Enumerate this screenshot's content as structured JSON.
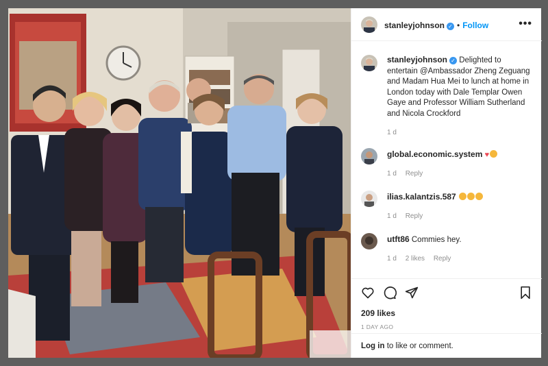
{
  "header": {
    "username": "stanleyjohnson",
    "follow_label": "Follow",
    "separator": "•",
    "more_label": "•••"
  },
  "caption": {
    "username": "stanleyjohnson",
    "text": "Delighted to entertain @Ambassador Zheng Zeguang and Madam Hua Mei to lunch at home in London today with Dale Templar Owen Gaye and Professor William Sutherland and Nicola Crockford",
    "time": "1 d"
  },
  "comments": [
    {
      "username": "global.economic.system",
      "text": "",
      "time": "1 d",
      "reply": "Reply",
      "likes": ""
    },
    {
      "username": "ilias.kalantzis.587",
      "text": "",
      "time": "1 d",
      "reply": "Reply",
      "likes": ""
    },
    {
      "username": "utft86",
      "text": "Commies hey.",
      "time": "1 d",
      "reply": "Reply",
      "likes": "2 likes"
    }
  ],
  "actions": {
    "like_icon": "heart-icon",
    "comment_icon": "comment-icon",
    "share_icon": "share-icon",
    "save_icon": "bookmark-icon"
  },
  "stats": {
    "likes": "209 likes",
    "posted": "1 DAY AGO"
  },
  "login": {
    "link": "Log in",
    "rest": "to like or comment."
  },
  "colors": {
    "accent": "#0095f6",
    "verified": "#3897f0",
    "text": "#262626",
    "muted": "#8e8e8e",
    "divider": "#efefef"
  }
}
